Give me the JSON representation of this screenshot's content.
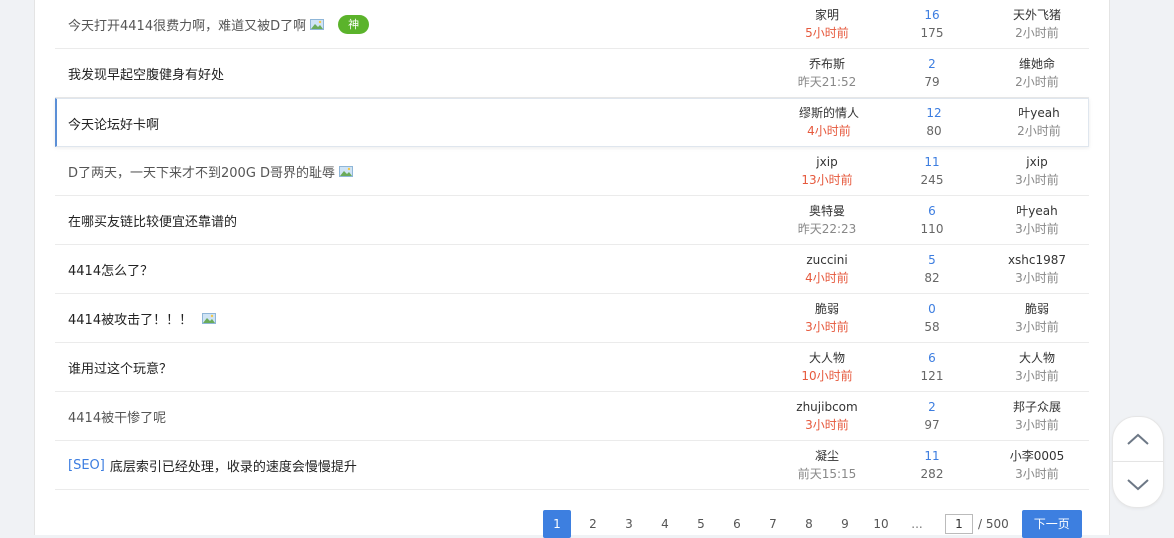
{
  "threads": [
    {
      "title": "今天打开4414很费力啊，难道又被D了啊",
      "has_image": true,
      "badge": "神",
      "author": "家明",
      "post_time": "5小时前",
      "replies": "16",
      "views": "175",
      "last_user": "天外飞猪",
      "last_time": "2小时前"
    },
    {
      "title": "我发现早起空腹健身有好处",
      "has_image": false,
      "author": "乔布斯",
      "post_time": "昨天21:52",
      "replies": "2",
      "views": "79",
      "last_user": "维她命",
      "last_time": "2小时前"
    },
    {
      "title": "今天论坛好卡啊",
      "has_image": false,
      "author": "缪斯的情人",
      "post_time": "4小时前",
      "replies": "12",
      "views": "80",
      "last_user": "叶yeah",
      "last_time": "2小时前"
    },
    {
      "title": "D了两天，一天下来才不到200G D哥界的耻辱",
      "has_image": true,
      "author": "jxip",
      "post_time": "13小时前",
      "replies": "11",
      "views": "245",
      "last_user": "jxip",
      "last_time": "3小时前"
    },
    {
      "title": "在哪买友链比较便宜还靠谱的",
      "has_image": false,
      "author": "奥特曼",
      "post_time": "昨天22:23",
      "replies": "6",
      "views": "110",
      "last_user": "叶yeah",
      "last_time": "3小时前"
    },
    {
      "title": "4414怎么了？",
      "has_image": false,
      "author": "zuccini",
      "post_time": "4小时前",
      "replies": "5",
      "views": "82",
      "last_user": "xshc1987",
      "last_time": "3小时前"
    },
    {
      "title": "4414被攻击了！！！",
      "has_image": true,
      "author": "脆弱",
      "post_time": "3小时前",
      "replies": "0",
      "views": "58",
      "last_user": "脆弱",
      "last_time": "3小时前"
    },
    {
      "title": "谁用过这个玩意？",
      "has_image": false,
      "author": "大人物",
      "post_time": "10小时前",
      "replies": "6",
      "views": "121",
      "last_user": "大人物",
      "last_time": "3小时前"
    },
    {
      "title": "4414被干惨了呢",
      "has_image": false,
      "author": "zhujibcom",
      "post_time": "3小时前",
      "replies": "2",
      "views": "97",
      "last_user": "邦子众展",
      "last_time": "3小时前"
    },
    {
      "tag": "[SEO]",
      "title": "底层索引已经处理，收录的速度会慢慢提升",
      "has_image": false,
      "author": "凝尘",
      "post_time": "前天15:15",
      "replies": "11",
      "views": "282",
      "last_user": "小李0005",
      "last_time": "3小时前"
    }
  ],
  "pagination": {
    "pages": [
      "1",
      "2",
      "3",
      "4",
      "5",
      "6",
      "7",
      "8",
      "9",
      "10"
    ],
    "current": "1",
    "ellipsis": "...",
    "input_value": "1",
    "total": "/ 500",
    "next_label": "下一页"
  },
  "floating_nav": {
    "up_icon": "chevron-up-icon",
    "down_icon": "chevron-down-icon"
  },
  "colors": {
    "accent": "#3d7fe0",
    "badge": "#5bb32b",
    "recent_time": "#e6593d"
  }
}
